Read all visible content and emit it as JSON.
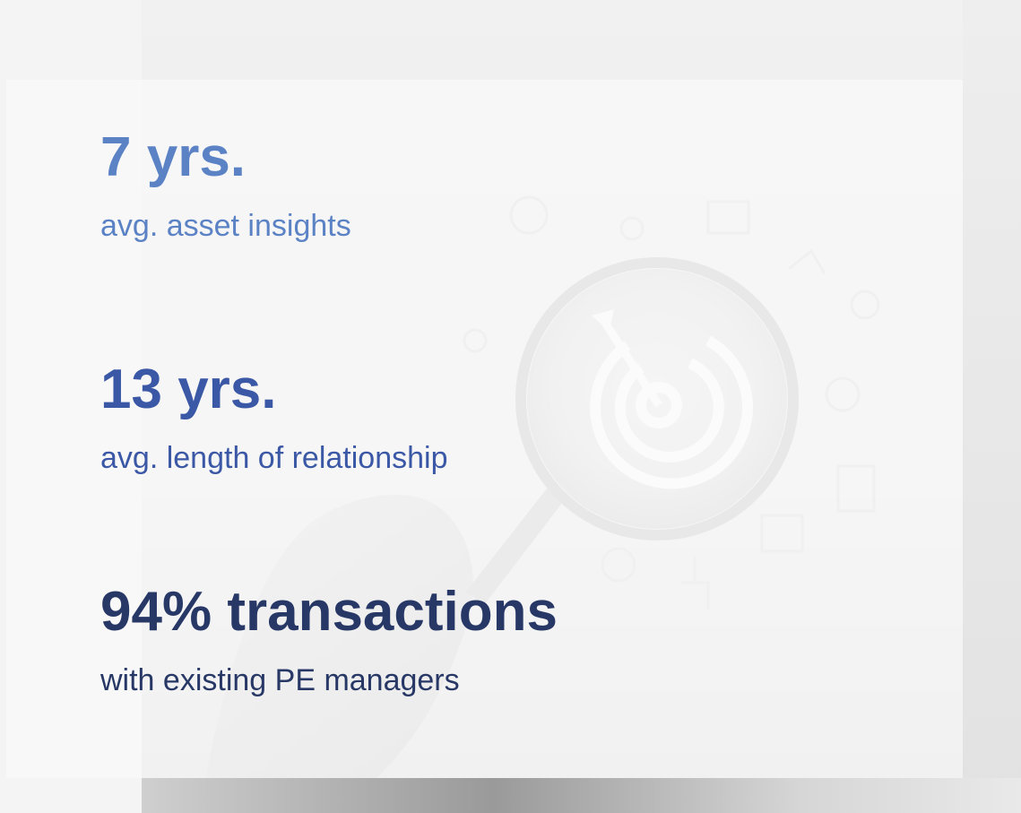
{
  "background": {
    "image_description_icon": "magnifying-glass-target-icon",
    "colors": {
      "page": "#efefef",
      "panel": "#fafafa"
    }
  },
  "stats": [
    {
      "value": "7 yrs.",
      "caption": "avg. asset insights",
      "color": "#5b82c4"
    },
    {
      "value": "13 yrs.",
      "caption": "avg. length of relationship",
      "color": "#3b58a6"
    },
    {
      "value": "94% transactions",
      "caption": "with existing PE managers",
      "color": "#283866"
    }
  ]
}
